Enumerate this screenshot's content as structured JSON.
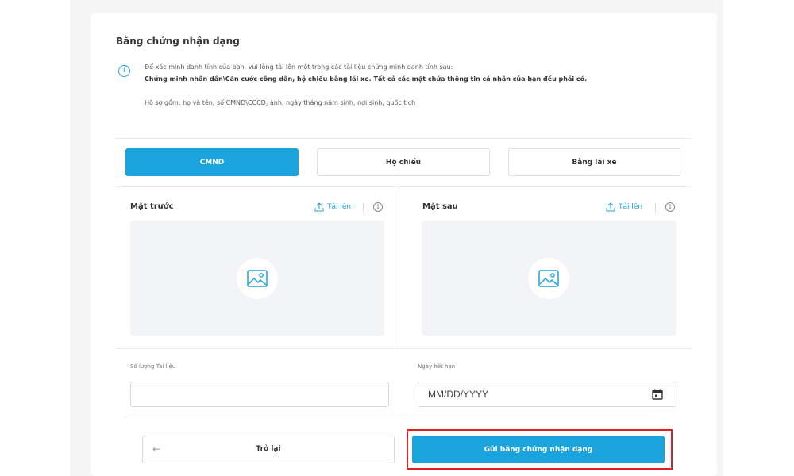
{
  "section": {
    "title": "Bằng chứng nhận dạng",
    "info_line1": "Để xác minh danh tính của bạn, vui lòng tải lên một trong các tài liệu chứng minh danh tính sau:",
    "info_line2": "Chứng minh nhân dân\\Căn cước công dân, hộ chiếu bằng lái xe. Tất cả các mặt chứa thông tin cá nhân của bạn đều phải có.",
    "info_line3": "Hồ sơ gồm: họ và tên, số CMND\\CCCD, ảnh, ngày tháng năm sinh, nơi sinh, quốc tịch"
  },
  "tabs": [
    {
      "label": "CMND",
      "active": true
    },
    {
      "label": "Hộ chiếu",
      "active": false
    },
    {
      "label": "Bằng lái xe",
      "active": false
    }
  ],
  "front": {
    "title": "Mặt trước",
    "upload_label": "Tải lên"
  },
  "back": {
    "title": "Mặt sau",
    "upload_label": "Tải lên"
  },
  "fields": {
    "doc_count_label": "Số lượng Tài liệu",
    "doc_count_value": "",
    "expiry_label": "Ngày hết hạn",
    "expiry_placeholder": "MM/DD/YYYY"
  },
  "actions": {
    "back_label": "Trở lại",
    "back_arrow": "←",
    "submit_label": "Gửi bằng chứng nhận dạng"
  },
  "colors": {
    "accent": "#1aa3dd",
    "highlight": "#e02020"
  }
}
